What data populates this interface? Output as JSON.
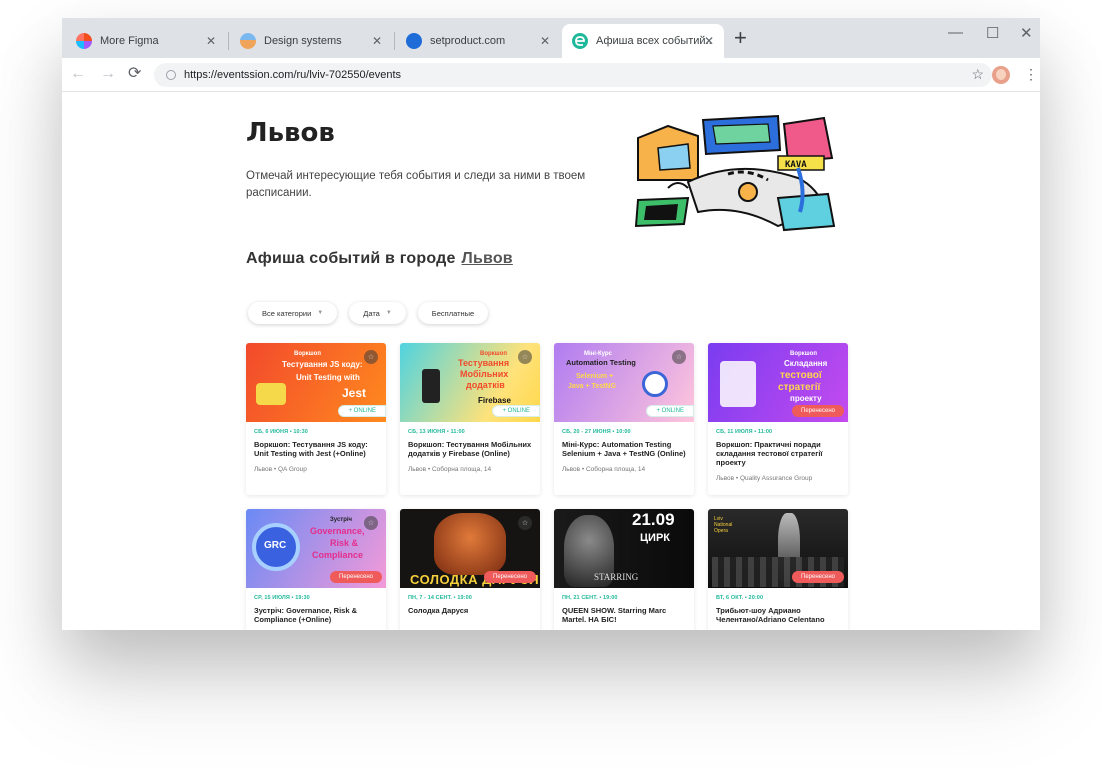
{
  "browser": {
    "tabs": [
      {
        "label": "More Figma",
        "active": false
      },
      {
        "label": "Design systems",
        "active": false
      },
      {
        "label": "setproduct.com",
        "active": false
      },
      {
        "label": "Афиша всех событий..",
        "active": true
      }
    ],
    "url": "https://eventssion.com/ru/lviv-702550/events",
    "window_controls": {
      "minimize": "—",
      "maximize": "☐",
      "close": "✕"
    },
    "new_tab": "+",
    "menu": "⋮",
    "star": "☆"
  },
  "hero": {
    "city": "Львов",
    "description": "Отмечай интересующие тебя события и следи за ними в твоем расписании.",
    "illustration_sign": "KAVA"
  },
  "section": {
    "title": "Афиша событий в городе",
    "city_link": "Львов"
  },
  "filters": [
    {
      "label": "Все категории",
      "dropdown": true
    },
    {
      "label": "Дата",
      "dropdown": true
    },
    {
      "label": "Бесплатные",
      "dropdown": false
    }
  ],
  "events": [
    {
      "date": "СБ, 6 ИЮНЯ • 10:30",
      "title": "Воркшоп: Тестування JS коду: Unit Testing with Jest (+Online)",
      "place": "Львов • QA Group",
      "badge": "+ ONLINE",
      "badge_type": "online",
      "thumb_lines": [
        "Воркшоп",
        "Тестування JS коду:",
        "Unit Testing with",
        "Jest"
      ],
      "thumb_colors": [
        "#f24a2c",
        "#ff8a1e"
      ]
    },
    {
      "date": "СБ, 13 ИЮНЯ • 11:00",
      "title": "Воркшоп: Тестування Мобільних додатків у Firebase (Online)",
      "place": "Львов • Соборна площа, 14",
      "badge": "+ ONLINE",
      "badge_type": "online",
      "thumb_lines": [
        "Воркшоп",
        "Тестування",
        "Мобільних",
        "додатків",
        "Firebase"
      ],
      "thumb_colors": [
        "#4fd3e0",
        "#ffd84a"
      ]
    },
    {
      "date": "СБ, 20 - 27 ИЮНЯ • 10:00",
      "title": "Міні-Курс: Automation Testing Selenium + Java + TestNG (Online)",
      "place": "Львов • Соборна площа, 14",
      "badge": "+ ONLINE",
      "badge_type": "online",
      "thumb_lines": [
        "Міні-Курс",
        "Automation Testing",
        "Selenium +",
        "Java + TestNG"
      ],
      "thumb_colors": [
        "#a56cf0",
        "#ffb6d0"
      ]
    },
    {
      "date": "СБ, 11 ИЮЛЯ • 11:00",
      "title": "Воркшоп: Практичні поради складання тестової стратегії проекту",
      "place": "Львов • Quality Assurance Group",
      "badge": "Перенесено",
      "badge_type": "moved",
      "thumb_lines": [
        "Воркшоп",
        "Складання",
        "тестової",
        "стратегії",
        "проекту"
      ],
      "thumb_colors": [
        "#7a3cf0",
        "#c44bef"
      ]
    },
    {
      "date": "СР, 15 ИЮЛЯ • 19:30",
      "title": "Зустріч: Governance, Risk & Compliance (+Online)",
      "place": "",
      "badge": "Перенесено",
      "badge_type": "moved",
      "thumb_lines": [
        "Зустріч",
        "Governance,",
        "Risk &",
        "Compliance",
        "GRC"
      ],
      "thumb_colors": [
        "#4a6cf0",
        "#f04ab8"
      ]
    },
    {
      "date": "ПН, 7 - 14 СЕНТ. • 19:00",
      "title": "Солодка Даруся",
      "place": "",
      "badge": "Перенесено",
      "badge_type": "moved",
      "thumb_lines": [
        "СОЛОДКА ДАРУСЯ"
      ],
      "thumb_colors": [
        "#1a1a1a",
        "#c25a2a"
      ]
    },
    {
      "date": "ПН, 21 СЕНТ. • 19:00",
      "title": "QUEEN SHOW. Starring Marc Martel. НА БІС!",
      "place": "",
      "badge": "",
      "badge_type": "none",
      "thumb_lines": [
        "21.09",
        "ЦИРК",
        "STARRING"
      ],
      "thumb_colors": [
        "#0d0d0d",
        "#444444"
      ]
    },
    {
      "date": "ВТ, 6 ОКТ. • 20:00",
      "title": "Трибьют-шоу Адриано Челентано/Adriano Celentano",
      "place": "",
      "badge": "Перенесено",
      "badge_type": "moved",
      "thumb_lines": [
        "Lviv",
        "National",
        "Opera"
      ],
      "thumb_colors": [
        "#111111",
        "#555555"
      ]
    }
  ]
}
